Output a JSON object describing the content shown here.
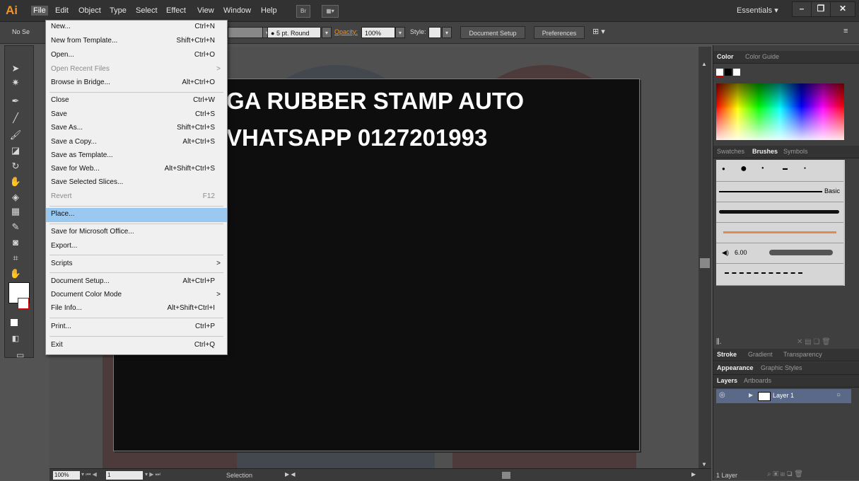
{
  "app": {
    "logo": "Ai"
  },
  "menubar": {
    "items": [
      "File",
      "Edit",
      "Object",
      "Type",
      "Select",
      "Effect",
      "View",
      "Window",
      "Help"
    ],
    "bridge_btn": "Br",
    "workspace": "Essentials",
    "workspace_arrow": "▾",
    "window_controls": {
      "minimize": "–",
      "restore": "❐",
      "close": "✕"
    }
  },
  "controlbar": {
    "selection_status": "No Se",
    "stroke_size": "5 pt. Round",
    "opacity_label": "Opacity:",
    "opacity_value": "100%",
    "style_label": "Style:",
    "document_setup": "Document Setup",
    "preferences": "Preferences"
  },
  "file_menu": {
    "items": [
      {
        "label": "New...",
        "shortcut": "Ctrl+N"
      },
      {
        "label": "New from Template...",
        "shortcut": "Shift+Ctrl+N"
      },
      {
        "label": "Open...",
        "shortcut": "Ctrl+O"
      },
      {
        "label": "Open Recent Files",
        "shortcut": "",
        "arrow": ">",
        "disabled": true
      },
      {
        "label": "Browse in Bridge...",
        "shortcut": "Alt+Ctrl+O"
      },
      {
        "label": "Close",
        "shortcut": "Ctrl+W"
      },
      {
        "label": "Save",
        "shortcut": "Ctrl+S"
      },
      {
        "label": "Save As...",
        "shortcut": "Shift+Ctrl+S"
      },
      {
        "label": "Save a Copy...",
        "shortcut": "Alt+Ctrl+S"
      },
      {
        "label": "Save as Template...",
        "shortcut": ""
      },
      {
        "label": "Save for Web...",
        "shortcut": "Alt+Shift+Ctrl+S"
      },
      {
        "label": "Save Selected Slices...",
        "shortcut": ""
      },
      {
        "label": "Revert",
        "shortcut": "F12",
        "disabled": true
      },
      {
        "label": "Place...",
        "shortcut": "",
        "highlighted": true
      },
      {
        "label": "Save for Microsoft Office...",
        "shortcut": ""
      },
      {
        "label": "Export...",
        "shortcut": ""
      },
      {
        "label": "Scripts",
        "shortcut": "",
        "arrow": ">"
      },
      {
        "label": "Document Setup...",
        "shortcut": "Alt+Ctrl+P"
      },
      {
        "label": "Document Color Mode",
        "shortcut": "",
        "arrow": ">"
      },
      {
        "label": "File Info...",
        "shortcut": "Alt+Shift+Ctrl+I"
      },
      {
        "label": "Print...",
        "shortcut": "Ctrl+P"
      },
      {
        "label": "Exit",
        "shortcut": "Ctrl+Q"
      }
    ]
  },
  "artboard": {
    "line1": "GA RUBBER STAMP AUTO",
    "line2": "VHATSAPP 0127201993"
  },
  "statusbar": {
    "zoom": "100%",
    "page": "1",
    "tool": "Selection"
  },
  "panels": {
    "color_tabs": [
      "Color",
      "Color Guide"
    ],
    "brush_tabs": [
      "Swatches",
      "Brushes",
      "Symbols"
    ],
    "brush_basic": "Basic",
    "brush_size": "6.00",
    "stroke_tabs": [
      "Stroke",
      "Gradient",
      "Transparency"
    ],
    "appearance_tabs": [
      "Appearance",
      "Graphic Styles"
    ],
    "layers_tabs": [
      "Layers",
      "Artboards"
    ],
    "layer_name": "Layer 1",
    "layer_count": "1 Layer"
  }
}
